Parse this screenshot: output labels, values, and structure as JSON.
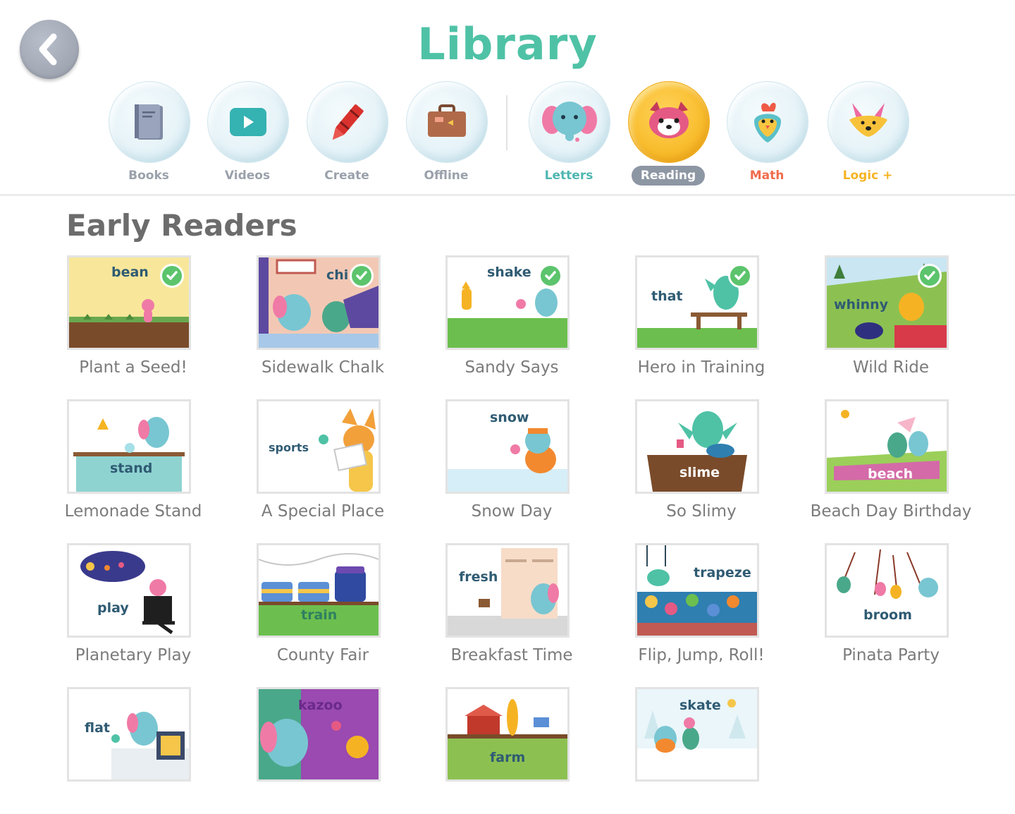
{
  "header": {
    "title": "Library",
    "nav": [
      {
        "label": "Books",
        "icon": "book-icon",
        "color": "#9aa1ab"
      },
      {
        "label": "Videos",
        "icon": "play-icon",
        "color": "#9aa1ab"
      },
      {
        "label": "Create",
        "icon": "crayon-icon",
        "color": "#9aa1ab"
      },
      {
        "label": "Offline",
        "icon": "suitcase-icon",
        "color": "#9aa1ab"
      },
      {
        "label": "Letters",
        "icon": "elephant-icon",
        "color": "#4fb6b1"
      },
      {
        "label": "Reading",
        "icon": "red-panda-icon",
        "color": "#ffffff",
        "active": true
      },
      {
        "label": "Math",
        "icon": "bird-icon",
        "color": "#f06c4c"
      },
      {
        "label": "Logic +",
        "icon": "fox-icon",
        "color": "#f5b324"
      }
    ]
  },
  "section": {
    "title": "Early Readers"
  },
  "books": [
    {
      "title": "Plant a Seed!",
      "word": "bean",
      "completed": true
    },
    {
      "title": "Sidewalk Chalk",
      "word": "chi",
      "completed": true
    },
    {
      "title": "Sandy Says",
      "word": "shake",
      "completed": true
    },
    {
      "title": "Hero in Training",
      "word": "that",
      "completed": true
    },
    {
      "title": "Wild Ride",
      "word": "whinny",
      "completed": true
    },
    {
      "title": "Lemonade Stand",
      "word": "stand",
      "completed": false
    },
    {
      "title": "A Special Place",
      "word": "sports",
      "completed": false
    },
    {
      "title": "Snow Day",
      "word": "snow",
      "completed": false
    },
    {
      "title": "So Slimy",
      "word": "slime",
      "completed": false
    },
    {
      "title": "Beach Day Birthday",
      "word": "beach",
      "completed": false
    },
    {
      "title": "Planetary Play",
      "word": "play",
      "completed": false
    },
    {
      "title": "County Fair",
      "word": "train",
      "completed": false
    },
    {
      "title": "Breakfast Time",
      "word": "fresh",
      "completed": false
    },
    {
      "title": "Flip, Jump, Roll!",
      "word": "trapeze",
      "completed": false
    },
    {
      "title": "Pinata Party",
      "word": "broom",
      "completed": false
    },
    {
      "title": "",
      "word": "flat",
      "completed": false
    },
    {
      "title": "",
      "word": "kazoo",
      "completed": false
    },
    {
      "title": "",
      "word": "farm",
      "completed": false
    },
    {
      "title": "",
      "word": "skate",
      "completed": false
    }
  ]
}
